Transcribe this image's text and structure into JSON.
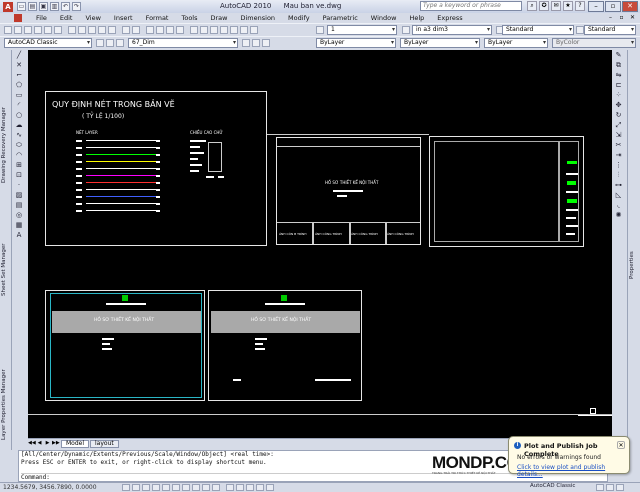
{
  "window": {
    "app_title": "AutoCAD 2010",
    "doc_title": "Mau ban ve.dwg",
    "search_placeholder": "Type a keyword or phrase"
  },
  "menu": [
    "File",
    "Edit",
    "View",
    "Insert",
    "Format",
    "Tools",
    "Draw",
    "Dimension",
    "Modify",
    "Parametric",
    "Window",
    "Help",
    "Express"
  ],
  "toolbar1": {
    "annotation_scale": "1",
    "dim_style": "in a3 dim3",
    "text_style": "Standard",
    "table_style": "Standard"
  },
  "toolbar2": {
    "workspace": "AutoCAD Classic",
    "layer": "67_Dim",
    "color": "ByLayer",
    "linetype": "ByLayer",
    "lineweight": "ByLayer",
    "plotstyle": "ByColor"
  },
  "palettes": {
    "drawing_recovery": "Drawing Recovery Manager",
    "sheet_set": "Sheet Set Manager",
    "layer_props": "Layer Properties Manager",
    "properties": "Properties"
  },
  "drawing": {
    "main_title": "QUY ĐỊNH NÉT TRONG BẢN VẼ",
    "scale_note": "( TỶ LỆ 1/100)",
    "col_linetype": "NÉT LAYER",
    "col_textheight": "CHIỀU CAO CHỮ",
    "sheet_title": "HỒ SƠ THIẾT KẾ NỘI THẤT",
    "footer_cells": [
      "ẢNH CÔN B TRÌNH",
      "ẢNH CÔNG TRÌNH",
      "ẢNH CÔNG TRÌNH",
      "ẢNH CÔNG TRÌNH"
    ],
    "line_colors": [
      "#ffffff",
      "#ffffff",
      "#00ff00",
      "#ffff00",
      "#ffffff",
      "#ff00ff",
      "#ff3030",
      "#4060ff",
      "#00ffff",
      "#ffffff"
    ]
  },
  "layout_tabs": [
    "Model",
    "layout"
  ],
  "command": {
    "line1": "[All/Center/Dynamic/Extents/Previous/Scale/Window/Object] <real time>:",
    "line2": "Press ESC or ENTER to exit, or right-click to display shortcut menu.",
    "prompt": "Command:"
  },
  "status": {
    "coords": "1234.5679, 3456.7890, 0.0000",
    "workspace": "AutoCAD Classic"
  },
  "notification": {
    "title": "Plot and Publish Job Complete",
    "message": "No errors or warnings found",
    "link": "Click to view plot and publish details..."
  },
  "watermark": {
    "brand": "MONDP.COM",
    "tagline": "TRANG TRẢI TRI THỨC THIẾT KẾ NỘI THẤT"
  }
}
